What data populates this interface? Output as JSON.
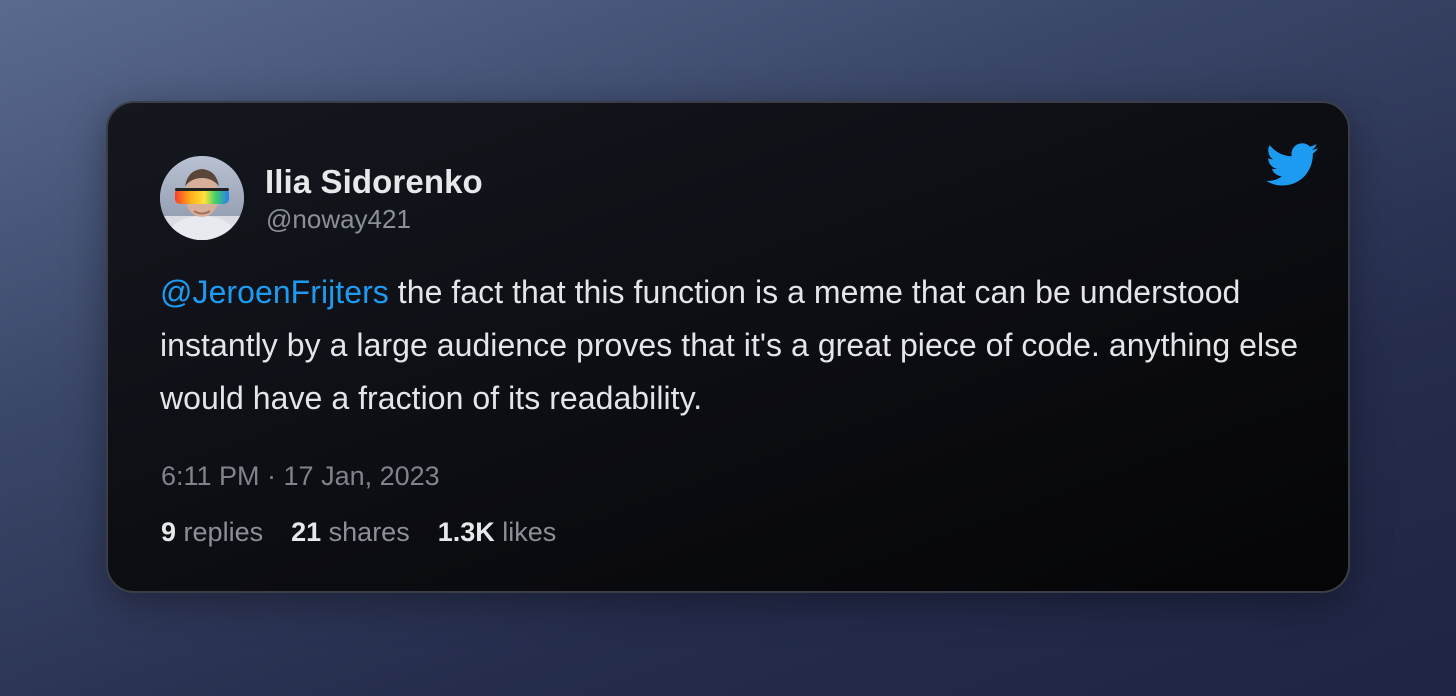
{
  "tweet": {
    "author": {
      "name": "Ilia Sidorenko",
      "handle": "@noway421",
      "avatar_icon": "user-avatar"
    },
    "logo_icon": "twitter-bird-icon",
    "logo_color": "#1d9bf0",
    "mention": "@JeroenFrijters",
    "body": " the fact that this function is a meme that can be understood instantly by a large audience proves that it's a great piece of code. anything else would have a fraction of its readability.",
    "timestamp": "6:11 PM · 17 Jan, 2023",
    "stats": {
      "replies_count": "9",
      "replies_label": "replies",
      "shares_count": "21",
      "shares_label": "shares",
      "likes_count": "1.3K",
      "likes_label": "likes"
    }
  },
  "colors": {
    "mention": "#1d9bf0",
    "card_background": "#0b0c11",
    "page_background": "#2d3556"
  }
}
